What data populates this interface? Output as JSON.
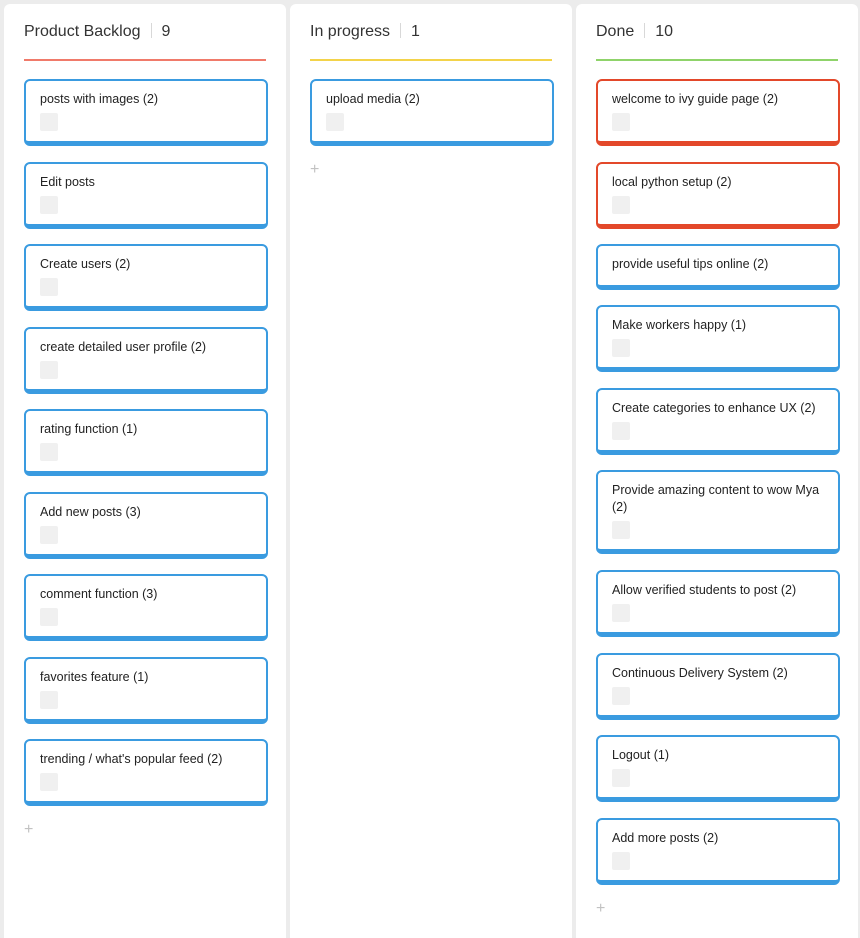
{
  "colors": {
    "card_border_default": "#3a9be0",
    "card_border_flagged": "#e3482a",
    "backlog_accent": "#f07a6a",
    "progress_accent": "#f3d34a",
    "done_accent": "#8fd36a"
  },
  "columns": [
    {
      "title": "Product Backlog",
      "count": "9",
      "add_icon": "+",
      "cards": [
        {
          "title": "posts with images (2)",
          "avatar": "avatar-placeholder"
        },
        {
          "title": "Edit posts",
          "avatar": "avatar-placeholder"
        },
        {
          "title": "Create users  (2)",
          "avatar": "avatar-placeholder"
        },
        {
          "title": "create detailed user profile (2)",
          "avatar": "avatar-placeholder"
        },
        {
          "title": "rating function (1)",
          "avatar": "avatar-placeholder"
        },
        {
          "title": "Add new posts (3)",
          "avatar": "avatar-placeholder"
        },
        {
          "title": "comment function (3)",
          "avatar": "avatar-placeholder"
        },
        {
          "title": "favorites feature (1)",
          "avatar": "avatar-placeholder"
        },
        {
          "title": "trending / what's popular feed (2)",
          "avatar": "avatar-placeholder"
        }
      ]
    },
    {
      "title": "In progress",
      "count": "1",
      "add_icon": "+",
      "cards": [
        {
          "title": "upload media (2)",
          "avatar": "avatar-placeholder"
        }
      ]
    },
    {
      "title": "Done",
      "count": "10",
      "add_icon": "+",
      "cards": [
        {
          "title": "welcome to ivy guide page (2)",
          "avatar": "avatar-placeholder",
          "flagged": true
        },
        {
          "title": "local python setup (2)",
          "avatar": "avatar-placeholder",
          "flagged": true
        },
        {
          "title": "provide useful tips online (2)"
        },
        {
          "title": "Make workers happy (1)",
          "avatar": "avatar-placeholder"
        },
        {
          "title": "Create categories to enhance UX (2)",
          "avatar": "avatar-placeholder"
        },
        {
          "title": "Provide amazing content to wow Mya (2)",
          "avatar": "avatar-placeholder"
        },
        {
          "title": "Allow verified students to post (2)",
          "avatar": "avatar-placeholder"
        },
        {
          "title": "Continuous Delivery System (2)",
          "avatar": "avatar-placeholder"
        },
        {
          "title": "Logout (1)",
          "avatar": "avatar-placeholder"
        },
        {
          "title": "Add more posts (2)",
          "avatar": "avatar-placeholder"
        }
      ]
    }
  ]
}
